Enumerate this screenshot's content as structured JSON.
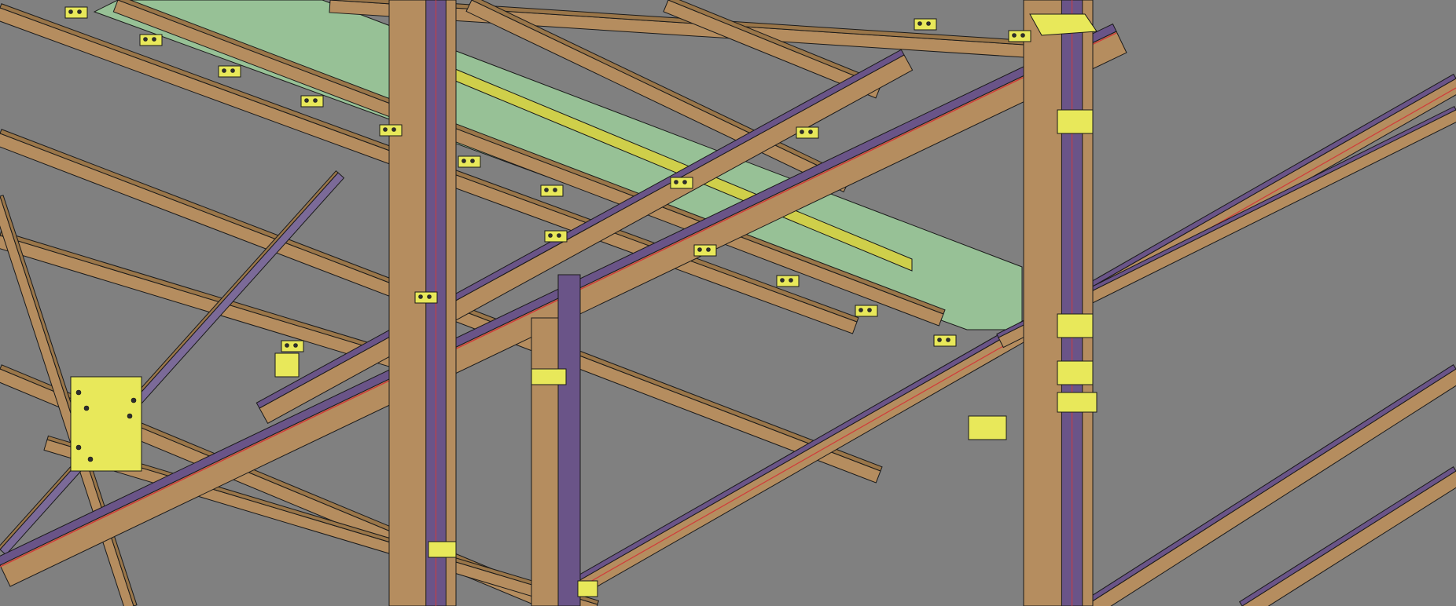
{
  "viewport": {
    "name": "3d-structural-model-viewport",
    "background": "#808080",
    "render_style": "shaded isometric steel frame"
  },
  "colors": {
    "beam_web": "#B58D5F",
    "beam_flange_shade": "#9A7649",
    "column_shadow": "#6A5488",
    "connection_plate": "#E8E85A",
    "deck": "#97C196",
    "bolt": "#2E2E2E",
    "centerline": "#D23A3A",
    "edge": "#1A1A1A"
  },
  "members": {
    "columns": [
      "column-left-center",
      "column-right",
      "stub-column-front"
    ],
    "primary_beams": [
      "rafter-main-diagonal",
      "eave-strut-lower",
      "beam-front-right"
    ],
    "secondary_beams": [
      "purlin-series"
    ],
    "bracing": [
      "x-brace-left",
      "x-brace-front"
    ],
    "deck_panels": [
      "deck-strip-green"
    ],
    "connections": [
      "base-plate",
      "gusset-plate",
      "clip-angle",
      "end-plate",
      "bolt-group"
    ]
  }
}
